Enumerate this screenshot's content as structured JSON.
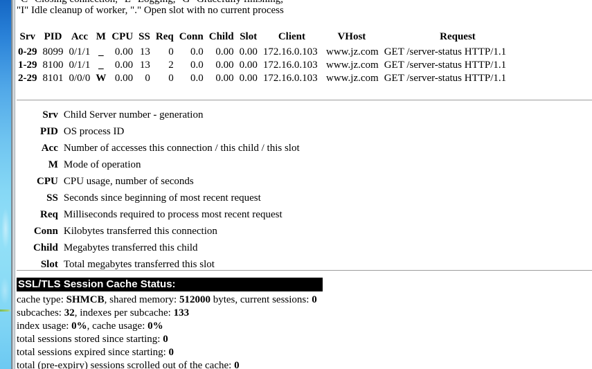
{
  "page": {
    "clipped_top_line": "\"C\" Closing connection, \"L\" Logging, \"G\" Gracefully finishing,",
    "legend_line_2": "\"I\" Idle cleanup of worker, \".\" Open slot with no current process"
  },
  "status_table": {
    "headers": [
      "Srv",
      "PID",
      "Acc",
      "M",
      "CPU",
      "SS",
      "Req",
      "Conn",
      "Child",
      "Slot",
      "Client",
      "VHost",
      "Request"
    ],
    "rows": [
      {
        "srv": "0-29",
        "pid": "8099",
        "acc": "0/1/1",
        "m": "_",
        "cpu": "0.00",
        "ss": "13",
        "req": "0",
        "conn": "0.0",
        "child": "0.00",
        "slot": "0.00",
        "client": "172.16.0.103",
        "vhost": "www.jz.com",
        "request": "GET /server-status HTTP/1.1"
      },
      {
        "srv": "1-29",
        "pid": "8100",
        "acc": "0/1/1",
        "m": "_",
        "cpu": "0.00",
        "ss": "13",
        "req": "2",
        "conn": "0.0",
        "child": "0.00",
        "slot": "0.00",
        "client": "172.16.0.103",
        "vhost": "www.jz.com",
        "request": "GET /server-status HTTP/1.1"
      },
      {
        "srv": "2-29",
        "pid": "8101",
        "acc": "0/0/0",
        "m": "W",
        "cpu": "0.00",
        "ss": "0",
        "req": "0",
        "conn": "0.0",
        "child": "0.00",
        "slot": "0.00",
        "client": "172.16.0.103",
        "vhost": "www.jz.com",
        "request": "GET /server-status HTTP/1.1"
      }
    ]
  },
  "definitions": [
    {
      "term": "Srv",
      "desc": "Child Server number - generation"
    },
    {
      "term": "PID",
      "desc": "OS process ID"
    },
    {
      "term": "Acc",
      "desc": "Number of accesses this connection / this child / this slot"
    },
    {
      "term": "M",
      "desc": "Mode of operation"
    },
    {
      "term": "CPU",
      "desc": "CPU usage, number of seconds"
    },
    {
      "term": "SS",
      "desc": "Seconds since beginning of most recent request"
    },
    {
      "term": "Req",
      "desc": "Milliseconds required to process most recent request"
    },
    {
      "term": "Conn",
      "desc": "Kilobytes transferred this connection"
    },
    {
      "term": "Child",
      "desc": "Megabytes transferred this child"
    },
    {
      "term": "Slot",
      "desc": "Total megabytes transferred this slot"
    }
  ],
  "ssl_section": {
    "heading": "SSL/TLS Session Cache Status:",
    "lines": [
      {
        "pre": "cache type: ",
        "b1": "SHMCB",
        "mid": ", shared memory: ",
        "b2": "512000",
        "mid2": " bytes, current sessions: ",
        "b3": "0",
        "post": ""
      },
      {
        "pre": "subcaches: ",
        "b1": "32",
        "mid": ", indexes per subcache: ",
        "b2": "133",
        "mid2": "",
        "b3": "",
        "post": ""
      },
      {
        "pre": "index usage: ",
        "b1": "0%",
        "mid": ", cache usage: ",
        "b2": "0%",
        "mid2": "",
        "b3": "",
        "post": ""
      },
      {
        "pre": "total sessions stored since starting: ",
        "b1": "0",
        "mid": "",
        "b2": "",
        "mid2": "",
        "b3": "",
        "post": ""
      },
      {
        "pre": "total sessions expired since starting: ",
        "b1": "0",
        "mid": "",
        "b2": "",
        "mid2": "",
        "b3": "",
        "post": ""
      },
      {
        "pre": "total (pre-expiry) sessions scrolled out of the cache: ",
        "b1": "0",
        "mid": "",
        "b2": "",
        "mid2": "",
        "b3": "",
        "post": ""
      }
    ]
  },
  "colors": {
    "heading_bg": "#000000",
    "heading_fg": "#ffffff",
    "rule": "#9b9b9b",
    "desktop_top": "#1567c4",
    "desktop_bottom": "#6cc9f2"
  }
}
